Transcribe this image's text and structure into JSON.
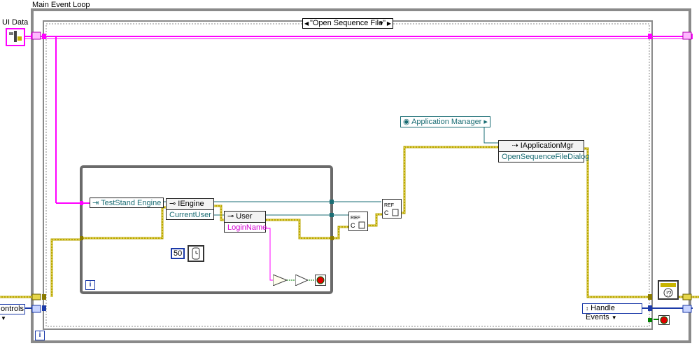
{
  "main_loop": {
    "label": "Main Event Loop",
    "iteration_terminal": "i"
  },
  "case_structure": {
    "selector_value": "\"Open Sequence File\""
  },
  "ui_data": {
    "label": "UI Data"
  },
  "controls_enum": {
    "value": "ontrols"
  },
  "handle_events_enum": {
    "value": "Handle Events"
  },
  "inner_loop": {
    "iteration_terminal": "i",
    "wait_ms": "50"
  },
  "engine_ref": {
    "label": "TestStand Engine"
  },
  "iengine_node": {
    "class": "IEngine",
    "property": "CurrentUser"
  },
  "user_node": {
    "class": "User",
    "property": "LoginName"
  },
  "app_mgr_ref": {
    "label": "Application Manager"
  },
  "iappmgr_node": {
    "class": "IApplicationMgr",
    "method": "OpenSequenceFileDialog"
  },
  "colors": {
    "ref_wire": "#ff00ff",
    "error_wire": "#c8b400",
    "teal_wire": "#1a6d74",
    "border_gray": "#808080"
  }
}
